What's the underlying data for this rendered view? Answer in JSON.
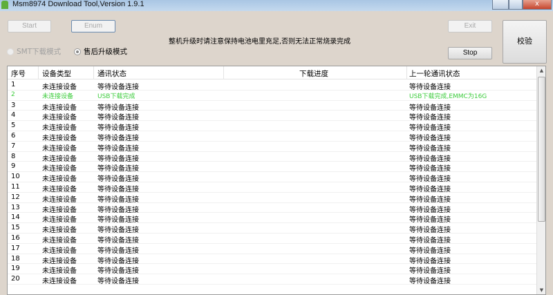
{
  "window": {
    "title": "Msm8974 Download Tool,Version 1.9.1",
    "close": "x"
  },
  "buttons": {
    "start": "Start",
    "enum": "Enum",
    "exit": "Exit",
    "stop": "Stop",
    "verify": "校验"
  },
  "notice": "整机升级时请注意保持电池电里充足,否则无法正常烧录完成",
  "modes": [
    {
      "label": "SMT下载模式",
      "selected": false,
      "enabled": false
    },
    {
      "label": "售后升级模式",
      "selected": true,
      "enabled": true
    }
  ],
  "table": {
    "headers": [
      "序号",
      "设备类型",
      "通讯状态",
      "下载进度",
      "上一轮通讯状态"
    ],
    "highlight_color": "#3ccc3c",
    "rows": [
      [
        "1",
        "未连接设备",
        "等待设备连接",
        "",
        "等待设备连接"
      ],
      [
        "2",
        "未连接设备",
        "USB下载完成",
        "",
        "USB下载完成,EMMC为16G"
      ],
      [
        "3",
        "未连接设备",
        "等待设备连接",
        "",
        "等待设备连接"
      ],
      [
        "4",
        "未连接设备",
        "等待设备连接",
        "",
        "等待设备连接"
      ],
      [
        "5",
        "未连接设备",
        "等待设备连接",
        "",
        "等待设备连接"
      ],
      [
        "6",
        "未连接设备",
        "等待设备连接",
        "",
        "等待设备连接"
      ],
      [
        "7",
        "未连接设备",
        "等待设备连接",
        "",
        "等待设备连接"
      ],
      [
        "8",
        "未连接设备",
        "等待设备连接",
        "",
        "等待设备连接"
      ],
      [
        "9",
        "未连接设备",
        "等待设备连接",
        "",
        "等待设备连接"
      ],
      [
        "10",
        "未连接设备",
        "等待设备连接",
        "",
        "等待设备连接"
      ],
      [
        "11",
        "未连接设备",
        "等待设备连接",
        "",
        "等待设备连接"
      ],
      [
        "12",
        "未连接设备",
        "等待设备连接",
        "",
        "等待设备连接"
      ],
      [
        "13",
        "未连接设备",
        "等待设备连接",
        "",
        "等待设备连接"
      ],
      [
        "14",
        "未连接设备",
        "等待设备连接",
        "",
        "等待设备连接"
      ],
      [
        "15",
        "未连接设备",
        "等待设备连接",
        "",
        "等待设备连接"
      ],
      [
        "16",
        "未连接设备",
        "等待设备连接",
        "",
        "等待设备连接"
      ],
      [
        "17",
        "未连接设备",
        "等待设备连接",
        "",
        "等待设备连接"
      ],
      [
        "18",
        "未连接设备",
        "等待设备连接",
        "",
        "等待设备连接"
      ],
      [
        "19",
        "未连接设备",
        "等待设备连接",
        "",
        "等待设备连接"
      ],
      [
        "20",
        "未连接设备",
        "等待设备连接",
        "",
        "等待设备连接"
      ]
    ]
  }
}
